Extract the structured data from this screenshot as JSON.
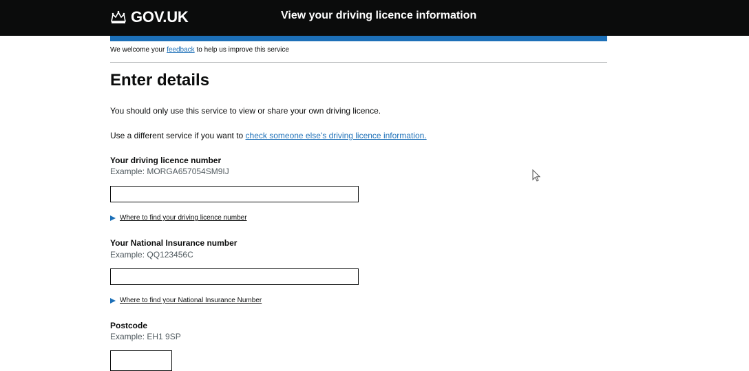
{
  "header": {
    "logo_text": "GOV.UK",
    "service_name": "View your driving licence information",
    "colors": {
      "background": "#0b0c0c",
      "accent_bar": "#1d70b8"
    }
  },
  "feedback": {
    "prefix": "We welcome your ",
    "link": "feedback",
    "suffix": " to help us improve this service"
  },
  "main": {
    "title": "Enter details",
    "intro": "You should only use this service to view or share your own driving licence.",
    "alt_service_prefix": "Use a different service if you want to ",
    "alt_service_link": "check someone else's driving licence information."
  },
  "form": {
    "licence": {
      "label": "Your driving licence number",
      "hint": "Example: MORGA657054SM9IJ",
      "value": "",
      "details": "Where to find your driving licence number"
    },
    "ni": {
      "label": "Your National Insurance number",
      "hint": "Example: QQ123456C",
      "value": "",
      "details": "Where to find your National Insurance Number"
    },
    "postcode": {
      "label": "Postcode",
      "hint": "Example: EH1 9SP",
      "value": ""
    }
  },
  "icons": [
    "crown-icon",
    "triangle-icon",
    "cursor-icon"
  ]
}
